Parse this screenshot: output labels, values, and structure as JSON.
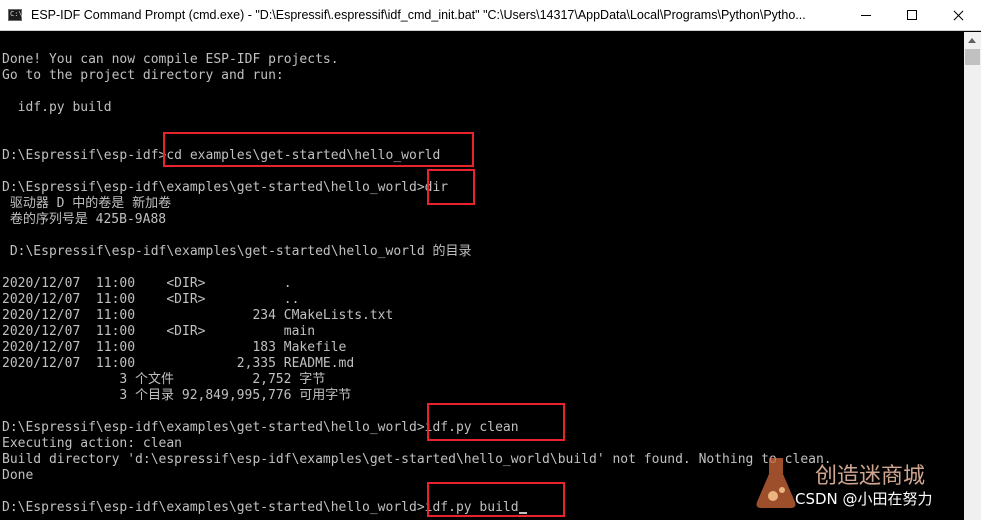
{
  "window": {
    "title": "ESP-IDF Command Prompt (cmd.exe) - \"D:\\Espressif\\.espressif\\idf_cmd_init.bat\" \"C:\\Users\\14317\\AppData\\Local\\Programs\\Python\\Pytho...",
    "app_icon_text": "C:\\"
  },
  "console": {
    "text_color": "#c0c0c0",
    "background": "#000000",
    "lines": [
      "",
      "Done! You can now compile ESP-IDF projects.",
      "Go to the project directory and run:",
      "",
      "  idf.py build",
      "",
      "",
      "D:\\Espressif\\esp-idf>cd examples\\get-started\\hello_world",
      "",
      "D:\\Espressif\\esp-idf\\examples\\get-started\\hello_world>dir",
      " 驱动器 D 中的卷是 新加卷",
      " 卷的序列号是 425B-9A88",
      "",
      " D:\\Espressif\\esp-idf\\examples\\get-started\\hello_world 的目录",
      "",
      "2020/12/07  11:00    <DIR>          .",
      "2020/12/07  11:00    <DIR>          ..",
      "2020/12/07  11:00               234 CMakeLists.txt",
      "2020/12/07  11:00    <DIR>          main",
      "2020/12/07  11:00               183 Makefile",
      "2020/12/07  11:00             2,335 README.md",
      "               3 个文件          2,752 字节",
      "               3 个目录 92,849,995,776 可用字节",
      "",
      "D:\\Espressif\\esp-idf\\examples\\get-started\\hello_world>idf.py clean",
      "Executing action: clean",
      "Build directory 'd:\\espressif\\esp-idf\\examples\\get-started\\hello_world\\build' not found. Nothing to clean.",
      "Done",
      "",
      "D:\\Espressif\\esp-idf\\examples\\get-started\\hello_world>idf.py build"
    ]
  },
  "annotations": {
    "color": "#e8232c"
  },
  "watermark": {
    "line1": "创造迷商城",
    "line2": "CSDN @小田在努力"
  }
}
